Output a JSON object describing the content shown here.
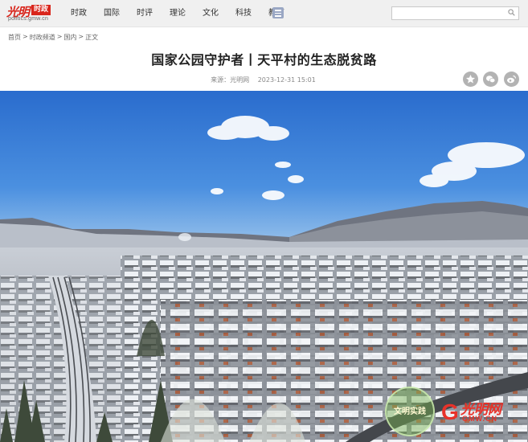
{
  "header": {
    "logo": {
      "brand": "光明",
      "tag": "时政",
      "url": "politics.gmw.cn"
    },
    "nav": [
      "时政",
      "国际",
      "时评",
      "理论",
      "文化",
      "科技",
      "教育"
    ],
    "search": {
      "value": "",
      "placeholder": ""
    }
  },
  "breadcrumb": [
    "首页",
    "时政频道",
    "国内",
    "正文"
  ],
  "article": {
    "title": "国家公园守护者丨天平村的生态脱贫路",
    "source_label": "来源：",
    "source": "光明网",
    "date": "2023-12-31 15:01"
  },
  "share": [
    "favorite-icon",
    "wechat-icon",
    "weibo-icon"
  ],
  "photo": {
    "watermark_seal": "文明实践",
    "watermark_brand": "光明网",
    "watermark_url": "GMW.CN"
  },
  "colors": {
    "brand_red": "#d9261c",
    "sky": "#3b7fd6"
  }
}
